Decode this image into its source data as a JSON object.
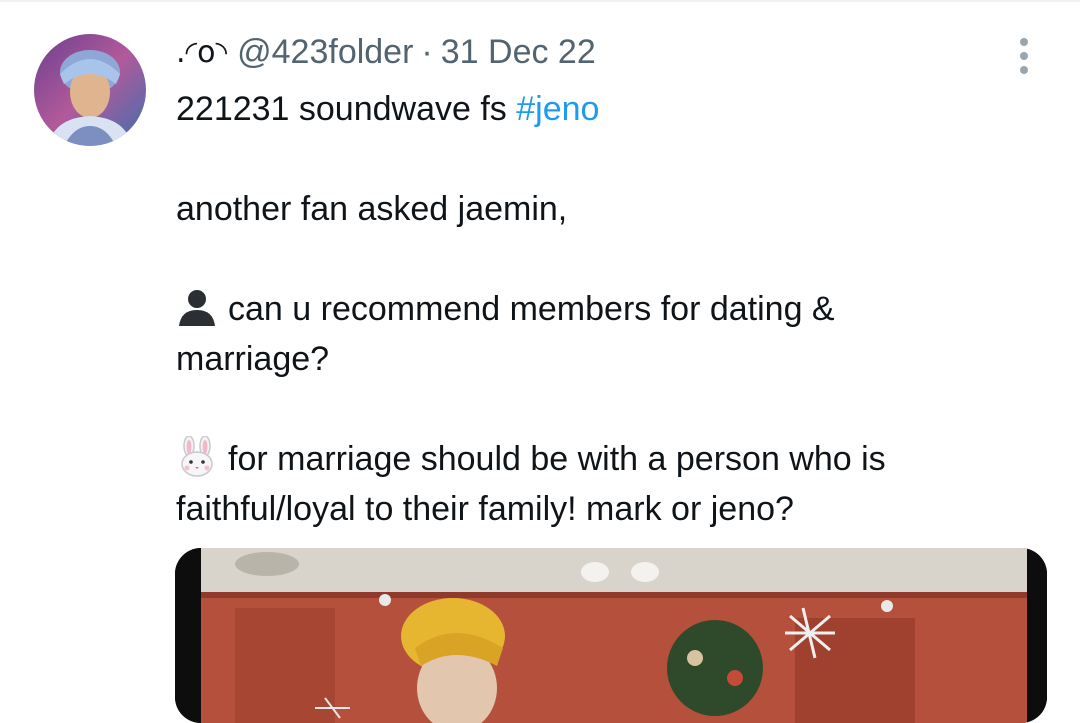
{
  "tweet": {
    "display_name": ".◜o◝",
    "handle": "@423folder",
    "separator": "·",
    "date": "31 Dec 22",
    "text": {
      "line1_plain": "221231 soundwave fs ",
      "line1_hashtag": "#jeno",
      "line2": "another fan asked jaemin,",
      "line3": "can u recommend members for dating &",
      "line4": "marriage?",
      "line5": "for marriage should be with a person who is",
      "line6": "faithful/loyal to their family! mark or jeno?"
    },
    "icons": {
      "speaker1": "bust-in-silhouette-emoji",
      "speaker2": "rabbit-face-emoji",
      "more": "more-vertical-icon"
    },
    "colors": {
      "hashtag": "#1d9bf0",
      "secondary_text": "#536471",
      "primary_text": "#0f1419"
    }
  }
}
